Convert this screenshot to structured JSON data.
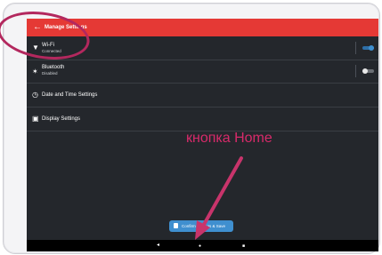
{
  "appbar": {
    "back_icon": "arrow-left-icon",
    "title": "Manage Settings"
  },
  "settings": [
    {
      "key": "wifi",
      "label": "Wi-Fi",
      "status": "Connected",
      "icon": "wifi-icon",
      "toggle_on": true
    },
    {
      "key": "bluetooth",
      "label": "Bluetooth",
      "status": "Disabled",
      "icon": "bluetooth-icon",
      "toggle_on": false
    },
    {
      "key": "datetime",
      "label": "Date and Time Settings",
      "icon": "clock-icon"
    },
    {
      "key": "display",
      "label": "Display Settings",
      "icon": "display-icon"
    }
  ],
  "save_button": {
    "label": "Confirm Settings & Save",
    "icon": "save-icon"
  },
  "navbar": {
    "back": "◂",
    "home": "●",
    "recents": "■"
  },
  "annotation": {
    "text": "кнопка Home"
  },
  "colors": {
    "appbar": "#e53935",
    "background": "#24272c",
    "toggle_on": "#3f8fcf",
    "annotation": "#d82a6a"
  }
}
